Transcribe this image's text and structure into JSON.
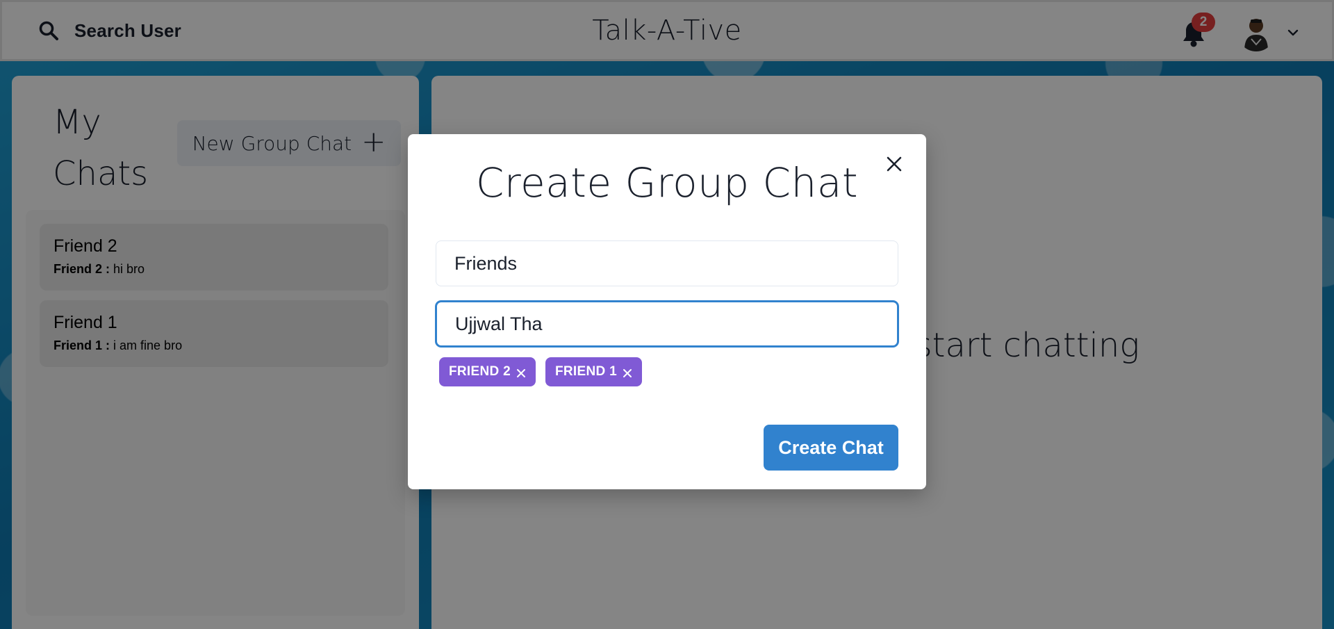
{
  "header": {
    "search_label": "Search User",
    "app_title": "Talk-A-Tive",
    "notification_count": "2"
  },
  "chats": {
    "title": "My Chats",
    "new_group_label": "New Group Chat",
    "items": [
      {
        "name": "Friend 2",
        "sender": "Friend 2 :",
        "message": "hi bro"
      },
      {
        "name": "Friend 1",
        "sender": "Friend 1 :",
        "message": "i am fine bro"
      }
    ]
  },
  "chatbox": {
    "hint": "Click on a user to start chatting"
  },
  "modal": {
    "title": "Create Group Chat",
    "chat_name_value": "Friends",
    "users_search_value": "Ujjwal Tha",
    "selected_users": [
      {
        "label": "FRIEND 2"
      },
      {
        "label": "FRIEND 1"
      }
    ],
    "create_label": "Create Chat"
  },
  "colors": {
    "accent": "#3182ce",
    "tag": "#805ad5",
    "badge": "#e53e3e"
  }
}
